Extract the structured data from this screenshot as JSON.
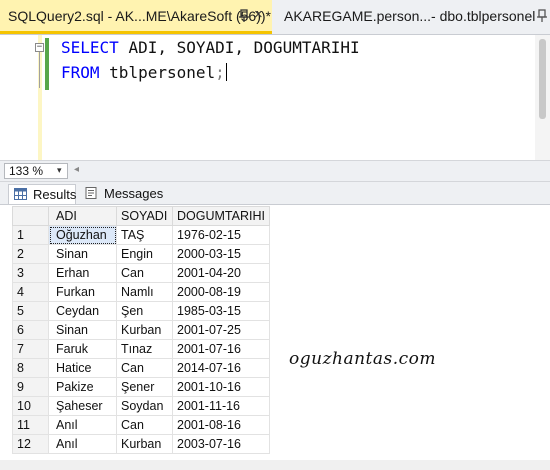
{
  "tabs": [
    {
      "title": "SQLQuery2.sql - AK...ME\\AkareSoft (56))*",
      "close": "×",
      "active": true
    },
    {
      "title": "AKAREGAME.person...- dbo.tblpersonel",
      "active": false
    }
  ],
  "editor": {
    "collapse_symbol": "−",
    "line1": {
      "kw1": "SELECT",
      "cols": "ADI, SOYADI, DOGUMTARIHI"
    },
    "line2": {
      "kw": "FROM",
      "table": "tblpersonel",
      "end": ";"
    }
  },
  "zoom": {
    "value": "133 %",
    "arrow": "▾",
    "left": "◂"
  },
  "result_tabs": {
    "results": "Results",
    "messages": "Messages"
  },
  "grid": {
    "columns": [
      "ADI",
      "SOYADI",
      "DOGUMTARIHI"
    ],
    "rows": [
      {
        "n": "1",
        "adi": "Oğuzhan",
        "soyadi": "TAŞ",
        "dogum": "1976-02-15"
      },
      {
        "n": "2",
        "adi": "Sinan",
        "soyadi": "Engin",
        "dogum": "2000-03-15"
      },
      {
        "n": "3",
        "adi": "Erhan",
        "soyadi": "Can",
        "dogum": "2001-04-20"
      },
      {
        "n": "4",
        "adi": "Furkan",
        "soyadi": "Namlı",
        "dogum": "2000-08-19"
      },
      {
        "n": "5",
        "adi": "Ceydan",
        "soyadi": "Şen",
        "dogum": "1985-03-15"
      },
      {
        "n": "6",
        "adi": "Sinan",
        "soyadi": "Kurban",
        "dogum": "2001-07-25"
      },
      {
        "n": "7",
        "adi": "Faruk",
        "soyadi": "Tınaz",
        "dogum": "2001-07-16"
      },
      {
        "n": "8",
        "adi": "Hatice",
        "soyadi": "Can",
        "dogum": "2014-07-16"
      },
      {
        "n": "9",
        "adi": "Pakize",
        "soyadi": "Şener",
        "dogum": "2001-10-16"
      },
      {
        "n": "10",
        "adi": "Şaheser",
        "soyadi": "Soydan",
        "dogum": "2001-11-16"
      },
      {
        "n": "11",
        "adi": "Anıl",
        "soyadi": "Can",
        "dogum": "2001-08-16"
      },
      {
        "n": "12",
        "adi": "Anıl",
        "soyadi": "Kurban",
        "dogum": "2003-07-16"
      }
    ]
  },
  "watermark": "oguzhantas.com",
  "colors": {
    "keyword": "#0000ff",
    "active_tab": "#fff3b0",
    "tab_underline": "#f5c400",
    "change_bar": "#57a64a"
  },
  "icons": {
    "results": "grid-icon",
    "messages": "messages-icon",
    "pin": "pin-icon"
  }
}
